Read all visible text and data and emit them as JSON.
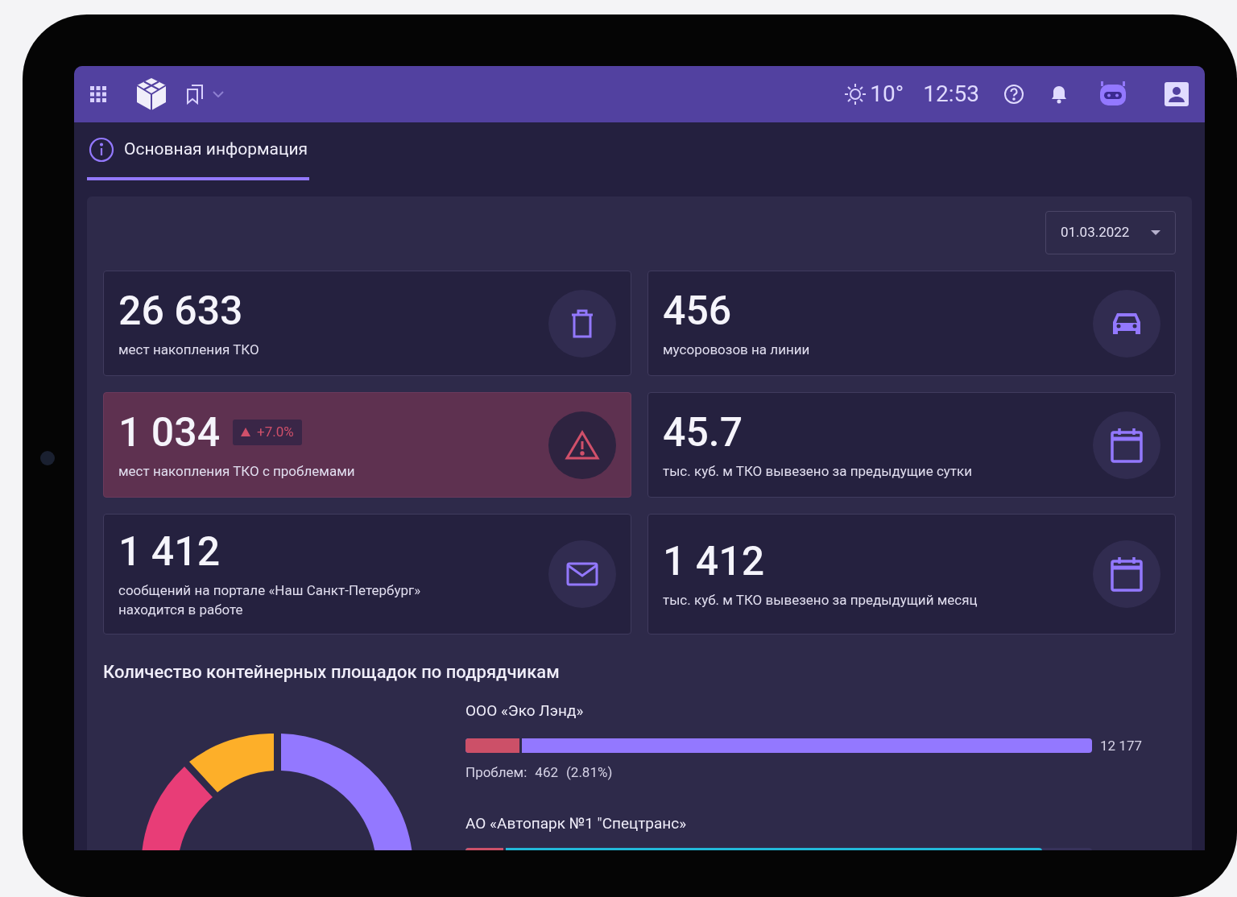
{
  "header": {
    "weather": "10°",
    "time": "12:53"
  },
  "tabs": [
    {
      "label": "Основная информация",
      "selected": true
    }
  ],
  "date_select": {
    "value": "01.03.2022"
  },
  "cards": [
    {
      "value": "26 633",
      "label": "мест накопления ТКО",
      "kind": "trash",
      "alert": false
    },
    {
      "value": "456",
      "label": "мусоровозов на линии",
      "kind": "car",
      "alert": false
    },
    {
      "value": "1 034",
      "badge": "+7.0%",
      "label": "мест накопления ТКО с проблемами",
      "kind": "warning",
      "alert": true
    },
    {
      "value": "45.7",
      "label": "тыс. куб. м ТКО вывезено за предыдущие сутки",
      "kind": "calendar",
      "alert": false
    },
    {
      "value": "1 412",
      "label": "сообщений на портале «Наш Санкт-Петербург» находится в работе",
      "kind": "mail",
      "alert": false
    },
    {
      "value": "1 412",
      "label": "тыс. куб. м ТКО вывезено за предыдущий месяц",
      "kind": "calendar",
      "alert": false
    }
  ],
  "section_title": "Количество контейнерных площадок по подрядчикам",
  "contractors": [
    {
      "name": "ООО «Эко Лэнд»",
      "color": "#9378ff",
      "bar": {
        "level": 1
      },
      "problem_bar": {
        "level": 0.09
      },
      "total": "12 177",
      "problems_label": "Проблем:",
      "problems_value": "462",
      "problems_share": "(2.81%)"
    },
    {
      "name": "АО «Автопарк №1 \"Спецтранс»",
      "color": "#22b8d8",
      "bar": {
        "level": 0.92
      },
      "problem_bar": {
        "level": 0.064
      }
    }
  ]
}
